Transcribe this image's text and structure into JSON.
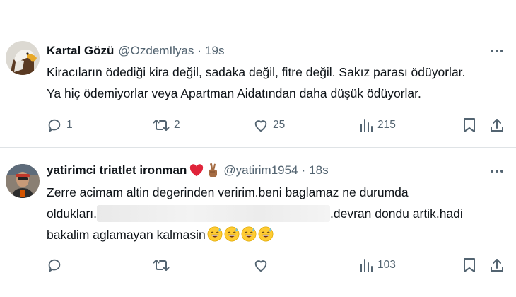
{
  "tweets": [
    {
      "name": "Kartal Gözü",
      "handle": "@OzdemIlyas",
      "separator": "·",
      "time": "19s",
      "text_lines": [
        "Kiracıların ödediği kira değil, sadaka değil, fitre değil. Sakız parası ödüyorlar.",
        "Ya hiç ödemiyorlar veya Apartman Aidatından daha düşük ödüyorlar."
      ],
      "actions": {
        "replies": "1",
        "reposts": "2",
        "likes": "25",
        "views": "215"
      }
    },
    {
      "name": "yatirimci triatlet ironman",
      "name_emojis": [
        "red-heart",
        "victory-hand"
      ],
      "handle": "@yatirim1954",
      "separator": "·",
      "time": "18s",
      "text_lines": [
        "Zerre acimam altin degerinden veririm.beni baglamaz ne durumda",
        "oldukları.",
        ".devran dondu artik.hadi",
        "bakalim aglamayan kalmasin"
      ],
      "trailing_emoji": "grinning-sweat-face",
      "trailing_emoji_count": 4,
      "actions": {
        "replies": "",
        "reposts": "",
        "likes": "",
        "views": "103"
      }
    }
  ],
  "icons": [
    "more-icon",
    "reply-icon",
    "repost-icon",
    "like-icon",
    "views-icon",
    "bookmark-icon",
    "share-icon"
  ]
}
